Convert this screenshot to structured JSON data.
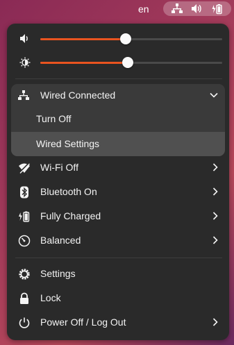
{
  "topbar": {
    "language": "en",
    "icons": [
      "network-wired-icon",
      "volume-icon",
      "battery-charging-icon"
    ]
  },
  "sliders": {
    "volume": {
      "icon": "volume-icon",
      "level": 0.47
    },
    "brightness": {
      "icon": "brightness-icon",
      "level": 0.48
    }
  },
  "network": {
    "title": "Wired Connected",
    "icon": "network-wired-icon",
    "expanded": true,
    "items": [
      "Turn Off",
      "Wired Settings"
    ]
  },
  "menu": {
    "wifi": "Wi-Fi Off",
    "bluetooth": "Bluetooth On",
    "battery": "Fully Charged",
    "power_mode": "Balanced",
    "settings": "Settings",
    "lock": "Lock",
    "power_off": "Power Off / Log Out"
  },
  "colors": {
    "accent": "#e95420",
    "panel": "#2a2a2a",
    "highlight": "#505050"
  }
}
